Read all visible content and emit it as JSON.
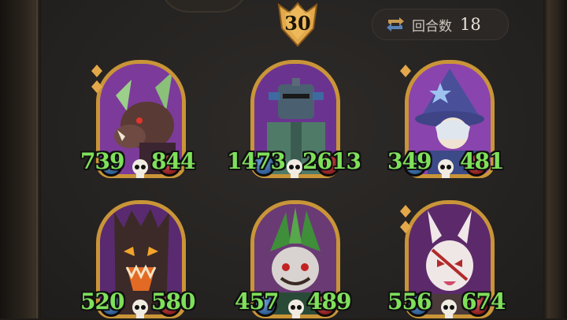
{
  "score": {
    "value": "30"
  },
  "rounds": {
    "label": "回合数",
    "value": "18",
    "icon": "cycle-arrows-icon"
  },
  "cards": [
    {
      "id": "boar",
      "attack": "739",
      "health": "844"
    },
    {
      "id": "knight",
      "attack": "1473",
      "health": "2613"
    },
    {
      "id": "wizard",
      "attack": "349",
      "health": "481"
    },
    {
      "id": "treant",
      "attack": "520",
      "health": "580"
    },
    {
      "id": "shaman",
      "attack": "457",
      "health": "489"
    },
    {
      "id": "rabbit",
      "attack": "556",
      "health": "674"
    }
  ],
  "colors": {
    "stat_text": "#7fe05a",
    "card_border": "#c99538",
    "card_bg": "#8f3fb0",
    "score_badge": "#e3a84a"
  }
}
